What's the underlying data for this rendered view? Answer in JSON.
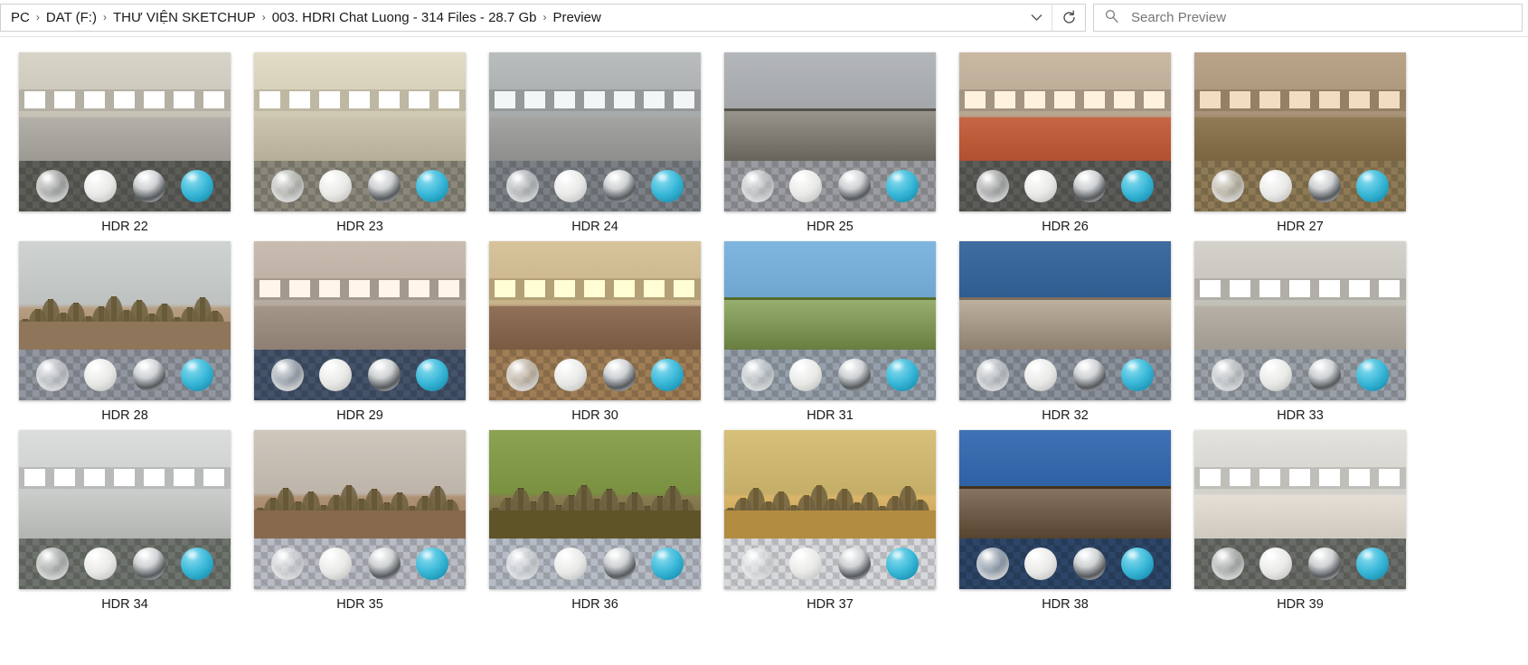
{
  "window": {
    "type": "file-explorer-preview"
  },
  "addressbar": {
    "breadcrumbs": [
      {
        "label": "PC"
      },
      {
        "label": "DAT  (F:)"
      },
      {
        "label": "THƯ VIỆN SKETCHUP"
      },
      {
        "label": "003. HDRI Chat Luong - 314 Files - 28.7 Gb"
      },
      {
        "label": "Preview"
      }
    ],
    "separator": "›",
    "dropdown_icon": "chevron-down-icon",
    "refresh_icon": "refresh-icon"
  },
  "search": {
    "placeholder": "Search Preview",
    "value": "",
    "icon": "search-icon"
  },
  "colors": {
    "background": "#ffffff",
    "text": "#1a1a1a",
    "border": "#cfcfcf",
    "placeholder": "#767676",
    "sphere_cyan": "#3ab8d8",
    "sphere_chrome": "#55595c",
    "sphere_diffuse": "#e9e9e7"
  },
  "grid": {
    "columns": 6,
    "rows": 3,
    "items": [
      {
        "label": "HDR 22",
        "scene": "abandoned-interior",
        "sky": "#d8d4c8",
        "ground": "#9c9a92",
        "floor": "#5d5d58"
      },
      {
        "label": "HDR 23",
        "scene": "construction-interior",
        "sky": "#e2dcc6",
        "ground": "#b6ae96",
        "floor": "#8b877a"
      },
      {
        "label": "HDR 24",
        "scene": "warehouse-interior",
        "sky": "#b9bdbd",
        "ground": "#8e8f8c",
        "floor": "#7b8086"
      },
      {
        "label": "HDR 25",
        "scene": "overcast-ruins",
        "sky": "#b4b7ba",
        "ground": "#7d7a72",
        "floor": "#9a9ca1"
      },
      {
        "label": "HDR 26",
        "scene": "studio-loft",
        "sky": "#c9b9a4",
        "ground": "#b0502f",
        "floor": "#5c5c58"
      },
      {
        "label": "HDR 27",
        "scene": "lobby-carpet",
        "sky": "#b9a489",
        "ground": "#7a6540",
        "floor": "#8e7a55"
      },
      {
        "label": "HDR 28",
        "scene": "autumn-forest",
        "sky": "#cfd3d2",
        "ground": "#9d8468",
        "floor": "#9296a0"
      },
      {
        "label": "HDR 29",
        "scene": "industrial-plant",
        "sky": "#c8bdb0",
        "ground": "#8d7f72",
        "floor": "#44536a"
      },
      {
        "label": "HDR 30",
        "scene": "living-room",
        "sky": "#d8c49b",
        "ground": "#7a5b42",
        "floor": "#9f7e56"
      },
      {
        "label": "HDR 31",
        "scene": "sunny-field",
        "sky": "#7fb6e0",
        "ground": "#7e9455",
        "floor": "#96a0ab"
      },
      {
        "label": "HDR 32",
        "scene": "coastal-dunes",
        "sky": "#3f6da0",
        "ground": "#a39684",
        "floor": "#8b929c"
      },
      {
        "label": "HDR 33",
        "scene": "artist-studio",
        "sky": "#d4d2cb",
        "ground": "#a09a90",
        "floor": "#9aa0a8"
      },
      {
        "label": "HDR 34",
        "scene": "white-hall",
        "sky": "#dcdedd",
        "ground": "#b3b5b2",
        "floor": "#6f736d"
      },
      {
        "label": "HDR 35",
        "scene": "bare-forest",
        "sky": "#cfc6bc",
        "ground": "#95775c",
        "floor": "#b9bcc4"
      },
      {
        "label": "HDR 36",
        "scene": "green-woodland",
        "sky": "#8ba352",
        "ground": "#6d6236",
        "floor": "#b6bcc6"
      },
      {
        "label": "HDR 37",
        "scene": "golden-autumn",
        "sky": "#d7c07a",
        "ground": "#c09a4f",
        "floor": "#d6d8dc"
      },
      {
        "label": "HDR 38",
        "scene": "garden-house",
        "sky": "#3f72b4",
        "ground": "#6c5a46",
        "floor": "#2d4668"
      },
      {
        "label": "HDR 39",
        "scene": "white-bathroom",
        "sky": "#e4e2dd",
        "ground": "#cfc9c0",
        "floor": "#6a6c68"
      }
    ],
    "sphere_set": [
      "glass",
      "diffuse",
      "chrome",
      "cyan"
    ]
  }
}
